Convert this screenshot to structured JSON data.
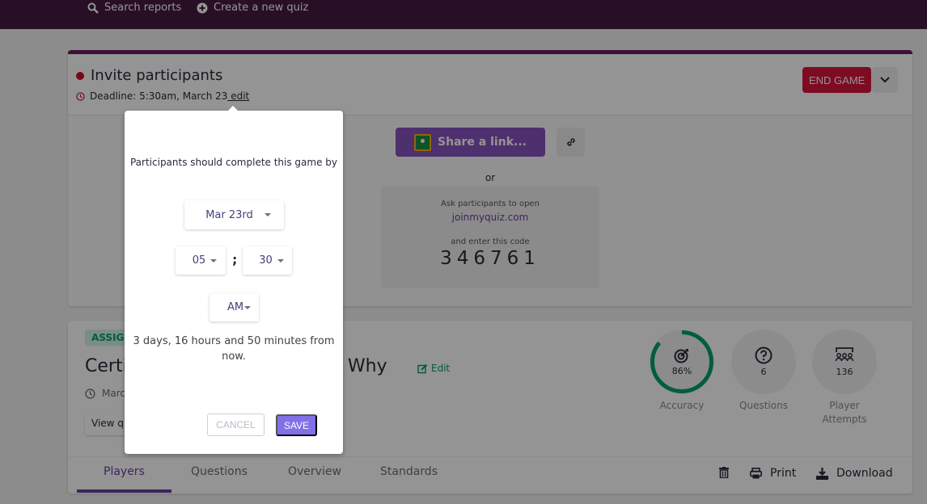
{
  "topnav": {
    "search_label": "Search reports",
    "create_label": "Create a new quiz"
  },
  "invite": {
    "title": "Invite participants",
    "deadline": "Deadline: 5:30am, March 23",
    "edit_label": " edit",
    "end_game_label": "END GAME",
    "share_label": "Share a link...",
    "or_label": "or",
    "ask_text": "Ask participants to open",
    "site": "joinmyquiz.com",
    "enter_text": "and enter this code",
    "code": "346761"
  },
  "report": {
    "badge": "ASSIGN",
    "title_left": "Certi",
    "title_right": "of Why",
    "edit_label": "Edit",
    "date_partial": "Marc",
    "view_label": "View q",
    "stats": [
      {
        "value": "86%",
        "label": "Accuracy",
        "fraction": 0.86
      },
      {
        "value": "6",
        "label": "Questions"
      },
      {
        "value": "136",
        "label": "Player Attempts"
      }
    ],
    "tabs": [
      "Players",
      "Questions",
      "Overview",
      "Standards"
    ],
    "active_tab": "Players",
    "tools": {
      "print_label": "Print",
      "download_label": "Download"
    }
  },
  "colors": {
    "accent_green": "#00a06a",
    "end_game_red": "#d7163d",
    "share_purple": "#8854c0",
    "save_purple": "#8171e8",
    "topbar": "#461a42"
  },
  "popover": {
    "title": "Participants should complete this game by",
    "date_value": "Mar 23rd",
    "hour_value": "05",
    "colon": ";",
    "minute_value": "30",
    "ampm_value": "AM",
    "remaining": "3 days, 16 hours and 50 minutes from now.",
    "cancel_label": "CANCEL",
    "save_label": "SAVE"
  }
}
